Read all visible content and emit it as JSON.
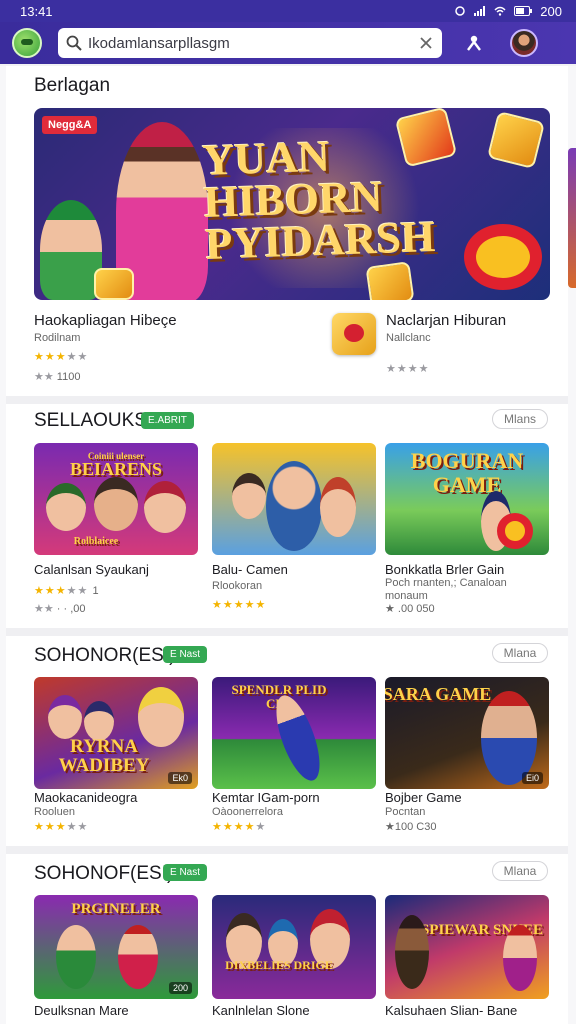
{
  "status_bar": {
    "time": "13:41",
    "battery": "200"
  },
  "search": {
    "value": "Ikodamlansarpllasgm"
  },
  "featured": {
    "heading": "Berlagan",
    "banner_tag": "Negg&A",
    "banner_title_lines": [
      "YUAN",
      "HIBORN",
      "PYIDARSH"
    ],
    "items": [
      {
        "name": "Haokapliagan Hibeçe",
        "sub": "Rodilnam",
        "rating": 3,
        "meta": "1100"
      },
      {
        "name": "Naclarjan Hiburan",
        "sub": "Nallclanc",
        "rating": 0,
        "meta": ""
      }
    ]
  },
  "sections": [
    {
      "title": "SELLAOUKS",
      "badge": "E.ABRIT",
      "more": "Mlans",
      "cards": [
        {
          "art_text": "BEIARENS",
          "art_sub": "Coiniii ulenser",
          "badge_text": "Rolblaicee",
          "count": "",
          "name": "Calanlsan Syaukanj",
          "sub": "",
          "rating": 3,
          "rating_text": "1",
          "meta": "· · ,00"
        },
        {
          "art_text": "",
          "count": "",
          "name": "Balu- Camen",
          "sub": "Rlookoran",
          "rating": 5,
          "rating_text": "",
          "meta": ""
        },
        {
          "art_text": "BOGURAN GAME",
          "count": "",
          "name": "Bonkkatla Brler Gain",
          "sub": "Poch rnanten,; Canaloan\nmonaum",
          "rating": 0,
          "rating_text": "",
          "meta": "★ .00 050"
        }
      ]
    },
    {
      "title": "SOHONOR(ESI)",
      "badge": "E Nast",
      "more": "Mlana",
      "cards": [
        {
          "art_text": "RYRNA WADIBEY",
          "count": "Ek0",
          "name": "Maokacanideogra",
          "sub": "Rooluen",
          "rating": 3,
          "rating_text": "",
          "meta": ""
        },
        {
          "art_text": "SPENDLR PLID CRS",
          "count": "",
          "name": "Kemtar IGam-porn",
          "sub": "Oàoonerrelora",
          "rating": 4,
          "rating_text": "",
          "meta": ""
        },
        {
          "art_text": "SARA GAME",
          "count": "Ei0",
          "name": "Bojber Game",
          "sub": "Pocntan",
          "rating": 0,
          "rating_text": "",
          "meta": "★100 C30"
        }
      ]
    },
    {
      "title": "SOHONOF(ESI)",
      "badge": "E Nast",
      "more": "Mlana",
      "cards": [
        {
          "art_text": "PRGINELER",
          "count": "200",
          "name": "Deulksnan Mare",
          "sub": "",
          "rating": 0,
          "rating_text": "",
          "meta": ""
        },
        {
          "art_text": "DIXBELIES DRIGE",
          "count": "",
          "name": "Kanlnlelan Slone",
          "sub": "",
          "rating": 0,
          "rating_text": "",
          "meta": ""
        },
        {
          "art_text": "SPIEWAR SNUEE",
          "count": "",
          "name": "Kalsuhaen Slian- Bane",
          "sub": "",
          "rating": 0,
          "rating_text": "",
          "meta": ""
        }
      ]
    }
  ],
  "colors": {
    "header": "#3b2fa0",
    "badge": "#34a853",
    "star": "#f4b400"
  },
  "icons": [
    "signal-icon",
    "wifi-icon",
    "battery-icon",
    "search-icon",
    "clear-icon",
    "person-icon",
    "avatar"
  ]
}
